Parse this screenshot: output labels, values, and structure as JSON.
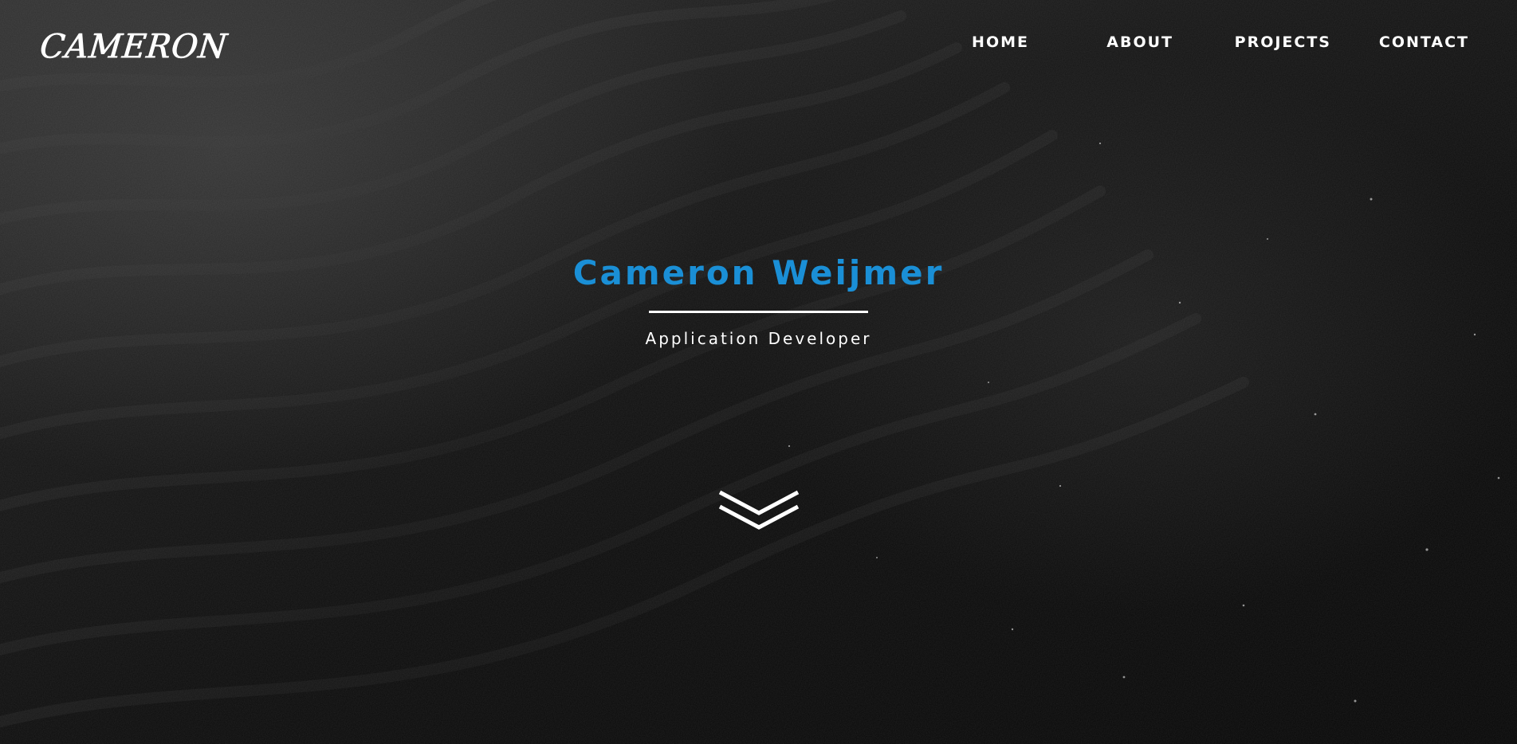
{
  "logo": {
    "text": "CAMERON"
  },
  "nav": {
    "items": [
      {
        "label": "HOME"
      },
      {
        "label": "ABOUT"
      },
      {
        "label": "PROJECTS"
      },
      {
        "label": "CONTACT"
      }
    ]
  },
  "hero": {
    "title": "Cameron Weijmer",
    "subtitle": "Application Developer",
    "scroll_icon": "double-chevron-down-icon"
  },
  "colors": {
    "accent": "#1a8fd6",
    "text": "#ffffff",
    "background": "#0a0a0a"
  }
}
